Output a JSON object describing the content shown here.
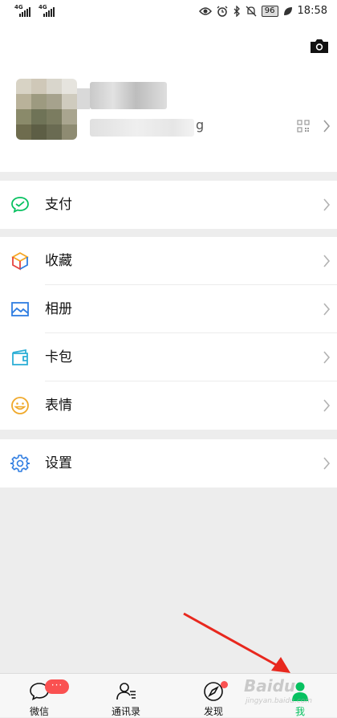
{
  "status_bar": {
    "network_1": "4G",
    "network_2": "4G",
    "battery": "96",
    "time": "18:58",
    "icons": [
      "eye-icon",
      "alarm-icon",
      "bluetooth-icon",
      "mute-icon",
      "leaf-icon"
    ]
  },
  "profile": {
    "wxid_tail": "g",
    "icons": [
      "camera-icon",
      "qr-code-icon",
      "chevron-right-icon"
    ]
  },
  "menu": {
    "pay": {
      "label": "支付",
      "icon": "wechat-pay-icon"
    },
    "favorites": {
      "label": "收藏",
      "icon": "cube-icon"
    },
    "album": {
      "label": "相册",
      "icon": "image-icon"
    },
    "cards": {
      "label": "卡包",
      "icon": "wallet-icon"
    },
    "stickers": {
      "label": "表情",
      "icon": "smiley-icon"
    },
    "settings": {
      "label": "设置",
      "icon": "gear-icon"
    }
  },
  "tabbar": {
    "chats": {
      "label": "微信",
      "badge": "···",
      "icon": "chat-bubble-icon"
    },
    "contacts": {
      "label": "通讯录",
      "icon": "contacts-icon"
    },
    "discover": {
      "label": "发现",
      "icon": "compass-icon"
    },
    "me": {
      "label": "我",
      "icon": "person-icon",
      "active": true
    }
  },
  "overlay": {
    "watermark_text": "Baidu",
    "watermark_sub": "jingyan.baidu.com"
  },
  "colors": {
    "accent": "#07c160",
    "badge": "#fa5151",
    "background": "#ededed",
    "arrow": "#e8281e"
  }
}
